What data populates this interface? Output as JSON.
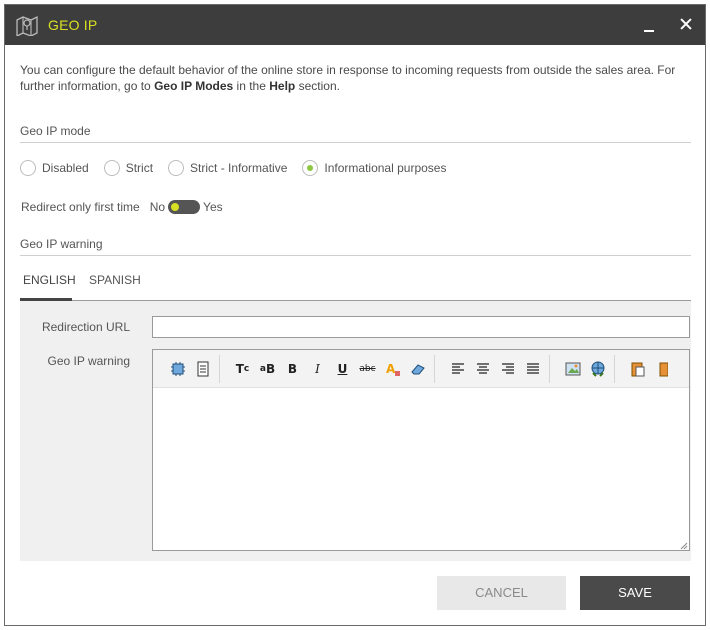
{
  "window": {
    "title": "GEO IP",
    "title_icon": "map-icon",
    "accent_color": "#d9e021",
    "titlebar_color": "#3d3d3d"
  },
  "intro": {
    "part1": "You can configure the default behavior of the online store in response to incoming requests from outside the sales area. For further information, go to ",
    "link1": "Geo IP Modes",
    "part2": " in the ",
    "link2": "Help",
    "part3": " section."
  },
  "geo_ip_mode": {
    "title": "Geo IP mode",
    "options": [
      {
        "label": "Disabled",
        "selected": false
      },
      {
        "label": "Strict",
        "selected": false
      },
      {
        "label": "Strict - Informative",
        "selected": false
      },
      {
        "label": "Informational purposes",
        "selected": true
      }
    ],
    "selected_color": "#8dc63f"
  },
  "redirect": {
    "label": "Redirect only first time",
    "off_label": "No",
    "on_label": "Yes",
    "value": false
  },
  "warning": {
    "title": "Geo IP warning",
    "tabs": [
      {
        "label": "ENGLISH",
        "active": true
      },
      {
        "label": "SPANISH",
        "active": false
      }
    ],
    "redirection_url_label": "Redirection URL",
    "redirection_url_value": "",
    "editor_label": "Geo IP warning",
    "editor_content": "",
    "toolbar": [
      [
        "source-code-icon",
        "document-icon"
      ],
      [
        "clear-format-icon",
        "font-size-icon",
        "bold-icon",
        "italic-icon",
        "underline-icon",
        "strikethrough-icon",
        "text-color-icon",
        "eraser-icon"
      ],
      [
        "align-left-icon",
        "align-center-icon",
        "align-right-icon",
        "justify-icon"
      ],
      [
        "insert-image-icon",
        "insert-link-icon"
      ],
      [
        "paste-icon",
        "more-icon"
      ]
    ]
  },
  "footer": {
    "cancel_label": "CANCEL",
    "save_label": "SAVE"
  }
}
